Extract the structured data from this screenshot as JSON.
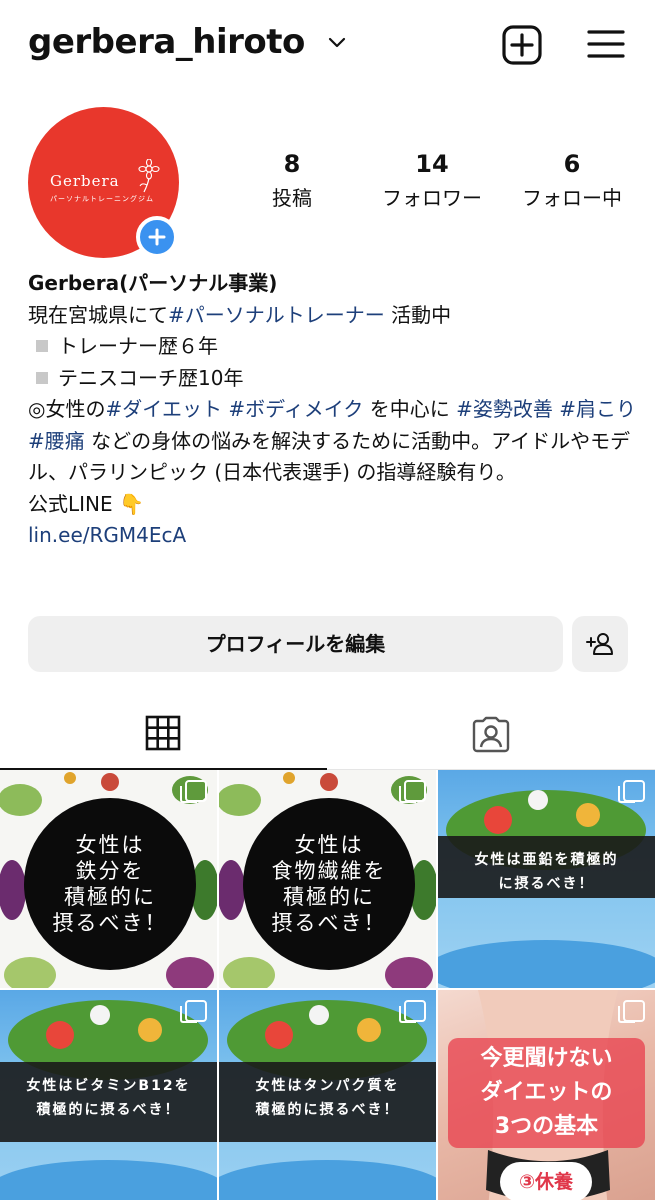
{
  "header": {
    "username": "gerbera_hiroto"
  },
  "avatar": {
    "brand": "Gerbera",
    "sub": "パーソナルトレーニングジム"
  },
  "stats": [
    {
      "value": "8",
      "label": "投稿"
    },
    {
      "value": "14",
      "label": "フォロワー"
    },
    {
      "value": "6",
      "label": "フォロー中"
    }
  ],
  "bio": {
    "name": "Gerbera(パーソナル事業)",
    "line1_pre": "現在宮城県にて",
    "line1_tag": "#パーソナルトレーナー",
    "line1_post": " 活動中",
    "line2": "トレーナー歴６年",
    "line3": "テニスコーチ歴10年",
    "line4_pre": "◎女性の",
    "tag_diet": "#ダイエット",
    "tag_bodymake": "#ボディメイク",
    "line4_mid": " を中心に ",
    "tag_posture": "#姿勢改善",
    "tag_katakori": "#肩こり",
    "tag_lowback": "#腰痛",
    "line5_post": " などの身体の悩みを解決するために活動中。アイドルやモデル、パラリンピック (日本代表選手) の指導経験有り。",
    "line_official": "公式LINE 👇",
    "link": "lin.ee/RGM4EcA"
  },
  "buttons": {
    "edit_profile": "プロフィールを編集"
  },
  "posts": [
    {
      "text_lines": [
        "女性は",
        "鉄分を",
        "積極的に",
        "摂るべき！"
      ]
    },
    {
      "text_lines": [
        "女性は",
        "食物繊維を",
        "積極的に",
        "摂るべき！"
      ]
    },
    {
      "text_lines": [
        "女性は亜鉛を積極的",
        "に摂るべき！"
      ]
    },
    {
      "text_lines": [
        "女性はビタミンB12を",
        "積極的に摂るべき！"
      ]
    },
    {
      "text_lines": [
        "女性はタンパク質を",
        "積極的に摂るべき！"
      ]
    },
    {
      "text_lines": [
        "今更聞けない",
        "ダイエットの",
        "3つの基本"
      ],
      "pill": "③休養"
    }
  ],
  "colors": {
    "avatar_bg": "#e8372c",
    "story_plus": "#3a92f0",
    "hashtag": "#1d3f7a",
    "button_bg": "#efefef"
  },
  "icons": [
    "chevron-down-icon",
    "new-post-icon",
    "menu-icon",
    "plus-icon",
    "add-person-icon",
    "grid-icon",
    "tagged-icon",
    "multi-image-icon"
  ]
}
